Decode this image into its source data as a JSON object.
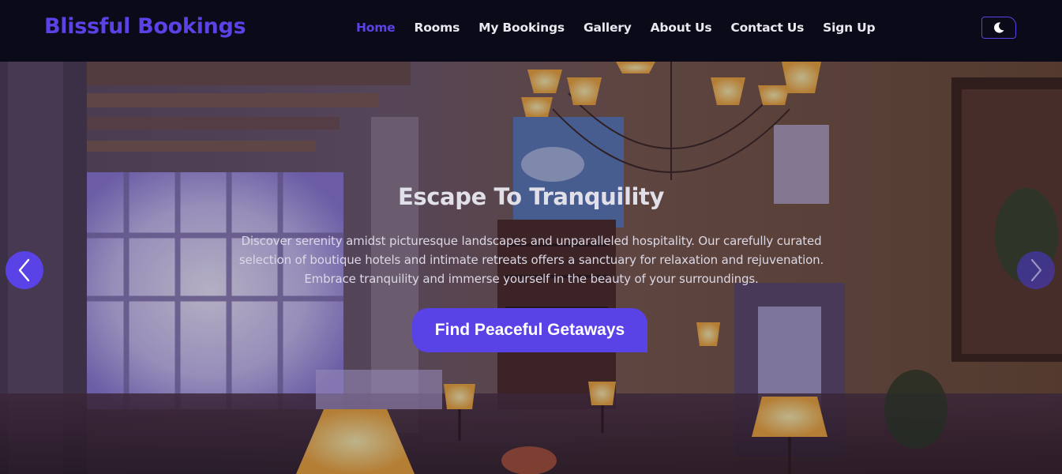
{
  "brand": {
    "name": "Blissful Bookings",
    "color": "#5a43e6"
  },
  "nav": {
    "items": [
      {
        "label": "Home",
        "active": true
      },
      {
        "label": "Rooms",
        "active": false
      },
      {
        "label": "My Bookings",
        "active": false
      },
      {
        "label": "Gallery",
        "active": false
      },
      {
        "label": "About Us",
        "active": false
      },
      {
        "label": "Contact Us",
        "active": false
      },
      {
        "label": "Sign Up",
        "active": false
      }
    ],
    "theme_toggle_icon": "moon-icon"
  },
  "hero": {
    "title": "Escape To Tranquility",
    "description": "Discover serenity amidst picturesque landscapes and unparalleled hospitality. Our carefully curated selection of boutique hotels and intimate retreats offers a sanctuary for relaxation and rejuvenation. Embrace tranquility and immerse yourself in the beauty of your surroundings.",
    "cta_label": "Find Peaceful Getaways",
    "prev_icon": "chevron-left-icon",
    "next_icon": "chevron-right-icon",
    "background": "hotel-lobby-image"
  },
  "colors": {
    "accent": "#5a43e6",
    "nav_bg": "#0a0a18",
    "nav_text": "#e8e8ee"
  }
}
